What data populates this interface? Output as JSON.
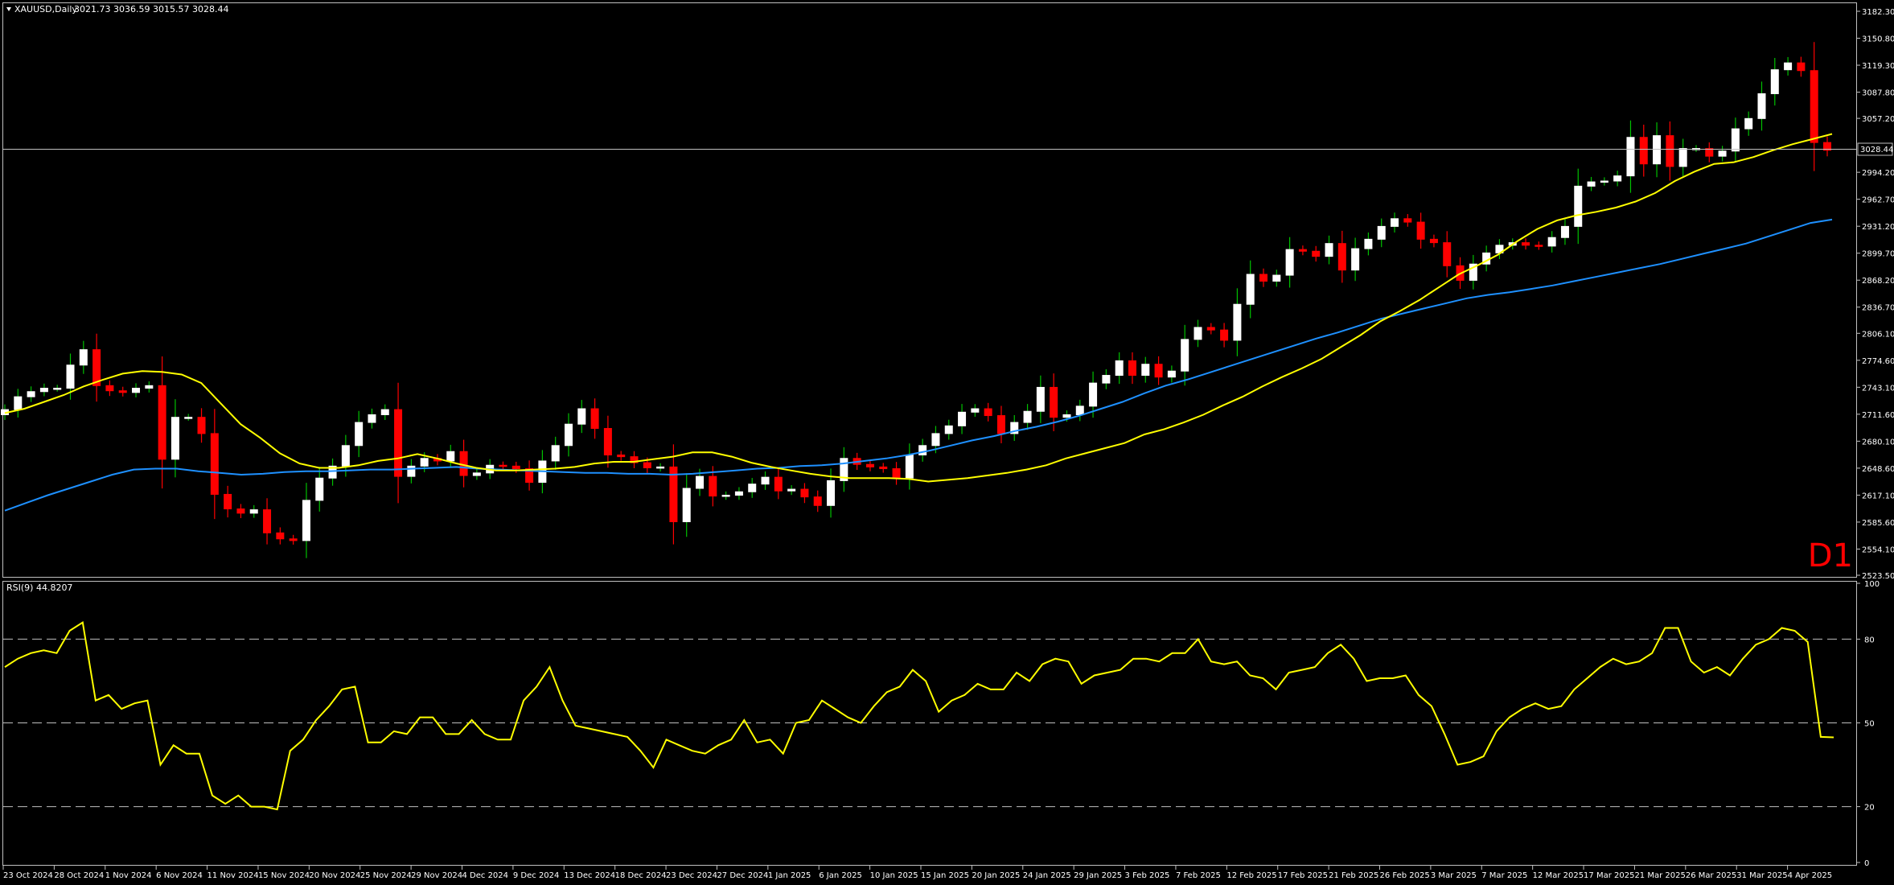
{
  "header": {
    "symbol_title": "XAUUSD,Daily",
    "ohlc": "3021.73 3036.59 3015.57 3028.44"
  },
  "timeframe_label": "D1",
  "rsi_header": "RSI(9) 44.8207",
  "current_price_label": "3028.44",
  "colors": {
    "bg": "#000000",
    "bull": "#ffffff",
    "bear": "#ff0000",
    "ma_fast": "#ffff00",
    "ma_slow": "#1e90ff",
    "rsi": "#ffff00",
    "grid": "#c0c0c0"
  },
  "chart_data": [
    {
      "type": "candlestick",
      "title": "XAUUSD,Daily",
      "ylim": [
        2523.5,
        3182.3
      ],
      "y_ticks": [
        "3182.30",
        "3150.80",
        "3119.30",
        "3087.80",
        "3057.20",
        "3028.44",
        "2994.20",
        "2962.70",
        "2931.20",
        "2899.70",
        "2868.20",
        "2836.70",
        "2806.10",
        "2774.60",
        "2743.10",
        "2711.60",
        "2680.10",
        "2648.60",
        "2617.10",
        "2585.60",
        "2554.10",
        "2523.50"
      ],
      "x_ticks": [
        "23 Oct 2024",
        "28 Oct 2024",
        "1 Nov 2024",
        "6 Nov 2024",
        "11 Nov 2024",
        "15 Nov 2024",
        "20 Nov 2024",
        "25 Nov 2024",
        "29 Nov 2024",
        "4 Dec 2024",
        "9 Dec 2024",
        "13 Dec 2024",
        "18 Dec 2024",
        "23 Dec 2024",
        "27 Dec 2024",
        "1 Jan 2025",
        "6 Jan 2025",
        "10 Jan 2025",
        "15 Jan 2025",
        "20 Jan 2025",
        "24 Jan 2025",
        "29 Jan 2025",
        "3 Feb 2025",
        "7 Feb 2025",
        "12 Feb 2025",
        "17 Feb 2025",
        "21 Feb 2025",
        "26 Feb 2025",
        "3 Mar 2025",
        "7 Mar 2025",
        "12 Mar 2025",
        "17 Mar 2025",
        "21 Mar 2025",
        "26 Mar 2025",
        "31 Mar 2025",
        "4 Apr 2025"
      ],
      "current_price": 3028.44,
      "close": [
        2717,
        2732,
        2738,
        2742,
        2742,
        2769,
        2787,
        2745,
        2739,
        2737,
        2742,
        2745,
        2659,
        2708,
        2708,
        2689,
        2618,
        2601,
        2596,
        2600,
        2573,
        2566,
        2564,
        2611,
        2637,
        2651,
        2675,
        2702,
        2711,
        2717,
        2639,
        2651,
        2660,
        2657,
        2668,
        2640,
        2643,
        2652,
        2651,
        2648,
        2632,
        2657,
        2675,
        2700,
        2718,
        2695,
        2664,
        2662,
        2655,
        2649,
        2650,
        2586,
        2625,
        2639,
        2616,
        2617,
        2621,
        2630,
        2638,
        2622,
        2624,
        2615,
        2605,
        2634,
        2660,
        2653,
        2650,
        2648,
        2637,
        2664,
        2675,
        2689,
        2698,
        2714,
        2718,
        2710,
        2689,
        2702,
        2715,
        2743,
        2708,
        2711,
        2721,
        2748,
        2757,
        2774,
        2757,
        2770,
        2755,
        2762,
        2799,
        2813,
        2810,
        2798,
        2840,
        2875,
        2867,
        2874,
        2904,
        2902,
        2896,
        2911,
        2880,
        2905,
        2916,
        2931,
        2940,
        2936,
        2916,
        2912,
        2885,
        2868,
        2887,
        2900,
        2909,
        2912,
        2909,
        2908,
        2918,
        2931,
        2978,
        2983,
        2984,
        2990,
        3035,
        3004,
        3037,
        3001,
        3022,
        3022,
        3013,
        3019,
        3045,
        3057,
        3086,
        3114,
        3122,
        3113,
        3029,
        3020
      ],
      "ma_fast_values": [
        2713,
        2718,
        2726,
        2734,
        2744,
        2752,
        2759,
        2762,
        2761,
        2758,
        2748,
        2724,
        2700,
        2684,
        2666,
        2654,
        2649,
        2649,
        2652,
        2657,
        2660,
        2665,
        2660,
        2654,
        2649,
        2646,
        2646,
        2647,
        2648,
        2650,
        2654,
        2656,
        2656,
        2659,
        2662,
        2667,
        2667,
        2662,
        2655,
        2650,
        2646,
        2642,
        2639,
        2637,
        2637,
        2637,
        2636,
        2633,
        2635,
        2637,
        2640,
        2643,
        2647,
        2652,
        2660,
        2666,
        2672,
        2678,
        2688,
        2694,
        2702,
        2711,
        2722,
        2732,
        2744,
        2755,
        2765,
        2776,
        2790,
        2804,
        2820,
        2832,
        2845,
        2860,
        2875,
        2886,
        2898,
        2914,
        2928,
        2938,
        2944,
        2948,
        2953,
        2960,
        2970,
        2984,
        2995,
        3004,
        3006,
        3012,
        3020,
        3027,
        3033,
        3039
      ],
      "ma_slow_values": [
        2599,
        2608,
        2617,
        2625,
        2633,
        2641,
        2647,
        2648,
        2648,
        2645,
        2643,
        2641,
        2642,
        2644,
        2645,
        2645,
        2646,
        2647,
        2647,
        2648,
        2649,
        2650,
        2648,
        2647,
        2646,
        2645,
        2644,
        2643,
        2643,
        2642,
        2642,
        2641,
        2642,
        2644,
        2646,
        2648,
        2649,
        2651,
        2652,
        2654,
        2657,
        2660,
        2664,
        2669,
        2675,
        2681,
        2686,
        2692,
        2697,
        2703,
        2710,
        2718,
        2726,
        2736,
        2745,
        2752,
        2760,
        2768,
        2776,
        2784,
        2792,
        2800,
        2807,
        2815,
        2823,
        2829,
        2835,
        2841,
        2847,
        2851,
        2854,
        2858,
        2862,
        2867,
        2872,
        2877,
        2882,
        2887,
        2893,
        2899,
        2905,
        2911,
        2919,
        2927,
        2935,
        2939
      ]
    },
    {
      "type": "line",
      "title": "RSI(9) 44.8207",
      "ylim": [
        0,
        100
      ],
      "y_ticks": [
        "100",
        "80",
        "50",
        "20",
        "0"
      ],
      "levels": [
        80,
        50,
        20
      ],
      "values": [
        70,
        73,
        75,
        76,
        75,
        83,
        86,
        58,
        60,
        55,
        57,
        58,
        35,
        42,
        39,
        39,
        24,
        21,
        24,
        20,
        20,
        19,
        40,
        44,
        51,
        56,
        62,
        63,
        43,
        43,
        47,
        46,
        52,
        52,
        46,
        46,
        51,
        46,
        44,
        44,
        58,
        63,
        70,
        58,
        49,
        48,
        47,
        46,
        45,
        40,
        34,
        44,
        42,
        40,
        39,
        42,
        44,
        51,
        43,
        44,
        39,
        50,
        51,
        58,
        55,
        52,
        50,
        56,
        61,
        63,
        69,
        65,
        54,
        58,
        60,
        64,
        62,
        62,
        68,
        65,
        71,
        73,
        72,
        64,
        67,
        68,
        69,
        73,
        73,
        72,
        75,
        75,
        80,
        72,
        71,
        72,
        67,
        66,
        62,
        68,
        69,
        70,
        75,
        78,
        73,
        65,
        66,
        66,
        67,
        60,
        56,
        46,
        35,
        36,
        38,
        47,
        52,
        55,
        57,
        55,
        56,
        62,
        66,
        70,
        73,
        71,
        72,
        75,
        84,
        84,
        72,
        68,
        70,
        67,
        73,
        78,
        80,
        84,
        83,
        79,
        45,
        44.8
      ]
    }
  ]
}
